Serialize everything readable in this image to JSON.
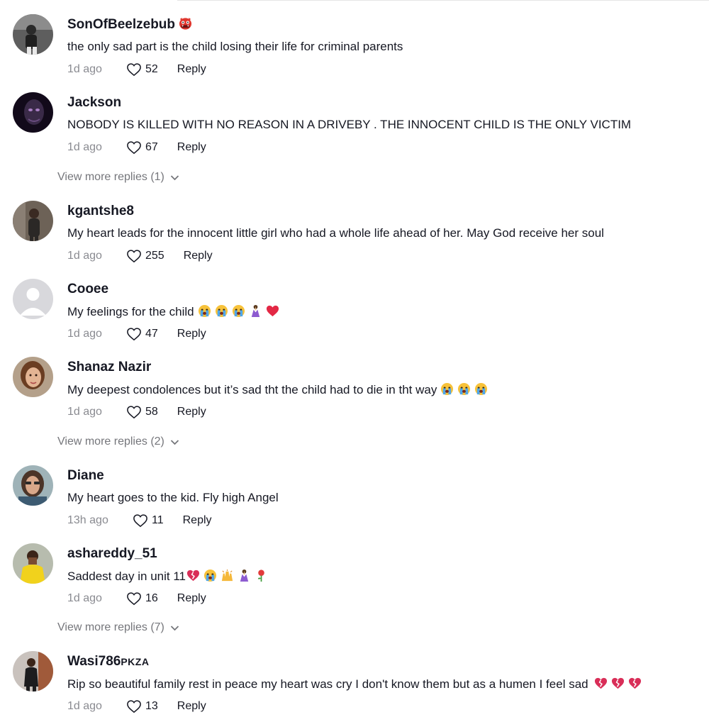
{
  "comments": [
    {
      "username": "SonOfBeelzebub",
      "username_suffix": "",
      "name_emoji": "ogre-icon",
      "text": "the only sad part is the child losing their life for criminal parents",
      "emojis": [],
      "time": "1d ago",
      "likes": "52",
      "reply_label": "Reply"
    },
    {
      "username": "Jackson",
      "username_suffix": "",
      "text": "NOBODY IS KILLED WITH NO REASON IN A DRIVEBY . THE INNOCENT CHILD IS THE ONLY VICTIM",
      "emojis": [],
      "time": "1d ago",
      "likes": "67",
      "reply_label": "Reply",
      "more_replies": "View more replies (1)"
    },
    {
      "username": "kgantshe8",
      "username_suffix": "",
      "text": "My heart leads for the innocent little girl who had a whole life ahead of her. May God receive her soul",
      "emojis": [],
      "time": "1d ago",
      "likes": "255",
      "reply_label": "Reply"
    },
    {
      "username": "Cooee",
      "username_suffix": "",
      "text": "My feelings for the child",
      "emojis": [
        "crying-face-icon",
        "crying-face-icon",
        "crying-face-icon",
        "praying-hands-icon",
        "red-heart-icon"
      ],
      "time": "1d ago",
      "likes": "47",
      "reply_label": "Reply"
    },
    {
      "username": "Shanaz Nazir",
      "username_suffix": "",
      "text": "My deepest condolences but it’s sad tht the child had to die in tht way",
      "emojis": [
        "crying-face-icon",
        "crying-face-icon",
        "crying-face-icon"
      ],
      "time": "1d ago",
      "likes": "58",
      "reply_label": "Reply",
      "more_replies": "View more replies (2)"
    },
    {
      "username": "Diane",
      "username_suffix": "",
      "text": "My heart goes to the kid. Fly high Angel",
      "emojis": [],
      "time": "13h ago",
      "likes": "11",
      "reply_label": "Reply"
    },
    {
      "username": "ashareddy_51",
      "username_suffix": "",
      "text": "Saddest day in unit 11",
      "emojis": [
        "broken-heart-icon",
        "crying-face-icon",
        "raised-hands-icon",
        "praying-hands-icon",
        "rose-icon"
      ],
      "time": "1d ago",
      "likes": "16",
      "reply_label": "Reply",
      "more_replies": "View more replies (7)"
    },
    {
      "username": "Wasi786",
      "username_suffix": "PKZA",
      "text": "Rip so beautiful family rest in peace my heart was cry I don't know them but as a humen I feel sad",
      "emojis": [
        "broken-heart-icon",
        "broken-heart-icon",
        "broken-heart-icon"
      ],
      "time": "1d ago",
      "likes": "13",
      "reply_label": "Reply"
    }
  ],
  "colors": {
    "text": "#161823",
    "muted": "#8a8b91",
    "more_replies": "#75767b"
  }
}
